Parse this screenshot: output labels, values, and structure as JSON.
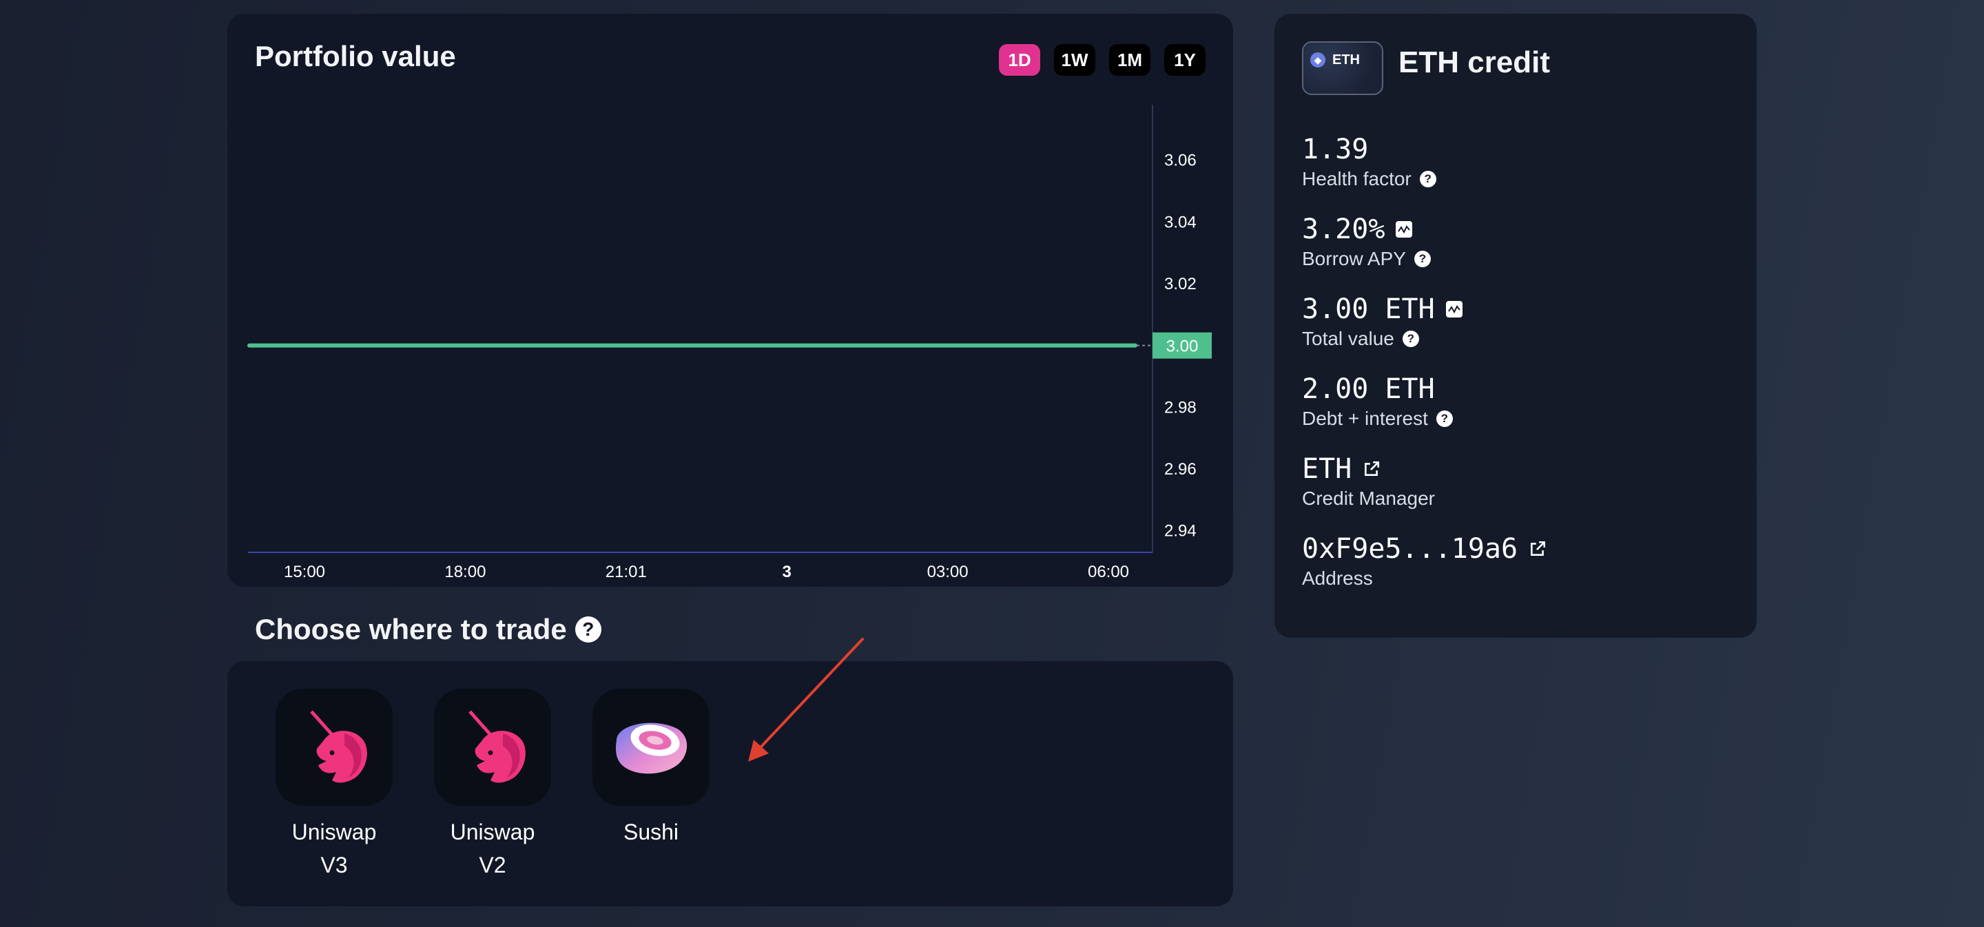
{
  "portfolio": {
    "title": "Portfolio value",
    "ranges": [
      "1D",
      "1W",
      "1M",
      "1Y"
    ],
    "active_range": "1D",
    "current_value_label": "3.00"
  },
  "chart_data": {
    "type": "line",
    "x_ticks": [
      "15:00",
      "18:00",
      "21:01",
      "3",
      "03:00",
      "06:00"
    ],
    "y_ticks": [
      "3.06",
      "3.04",
      "3.02",
      "2.98",
      "2.96",
      "2.94"
    ],
    "ylim": [
      2.933,
      3.078
    ],
    "series": [
      {
        "values": [
          3.0,
          3.0,
          3.0,
          3.0,
          3.0,
          3.0
        ]
      }
    ],
    "line_color": "#4fc08d",
    "grid": false
  },
  "trade": {
    "title": "Choose where to trade",
    "venues": [
      {
        "name_line1": "Uniswap",
        "name_line2": "V3",
        "icon": "uniswap-unicorn-icon"
      },
      {
        "name_line1": "Uniswap",
        "name_line2": "V2",
        "icon": "uniswap-unicorn-icon"
      },
      {
        "name_line1": "Sushi",
        "name_line2": "",
        "icon": "sushi-icon"
      }
    ]
  },
  "credit": {
    "badge_text": "ETH",
    "title": "ETH credit",
    "stats": [
      {
        "value": "1.39",
        "label": "Health factor"
      },
      {
        "value": "3.20%",
        "label": "Borrow APY"
      },
      {
        "value": "3.00 ETH",
        "label": "Total value"
      },
      {
        "value": "2.00 ETH",
        "label": "Debt + interest"
      },
      {
        "value": "ETH",
        "label": "Credit Manager"
      },
      {
        "value": "0xF9e5...19a6",
        "label": "Address"
      }
    ]
  },
  "colors": {
    "accent": "#e0338f",
    "line": "#4fc08d",
    "card": "#111726",
    "arrow": "#e0402f"
  }
}
